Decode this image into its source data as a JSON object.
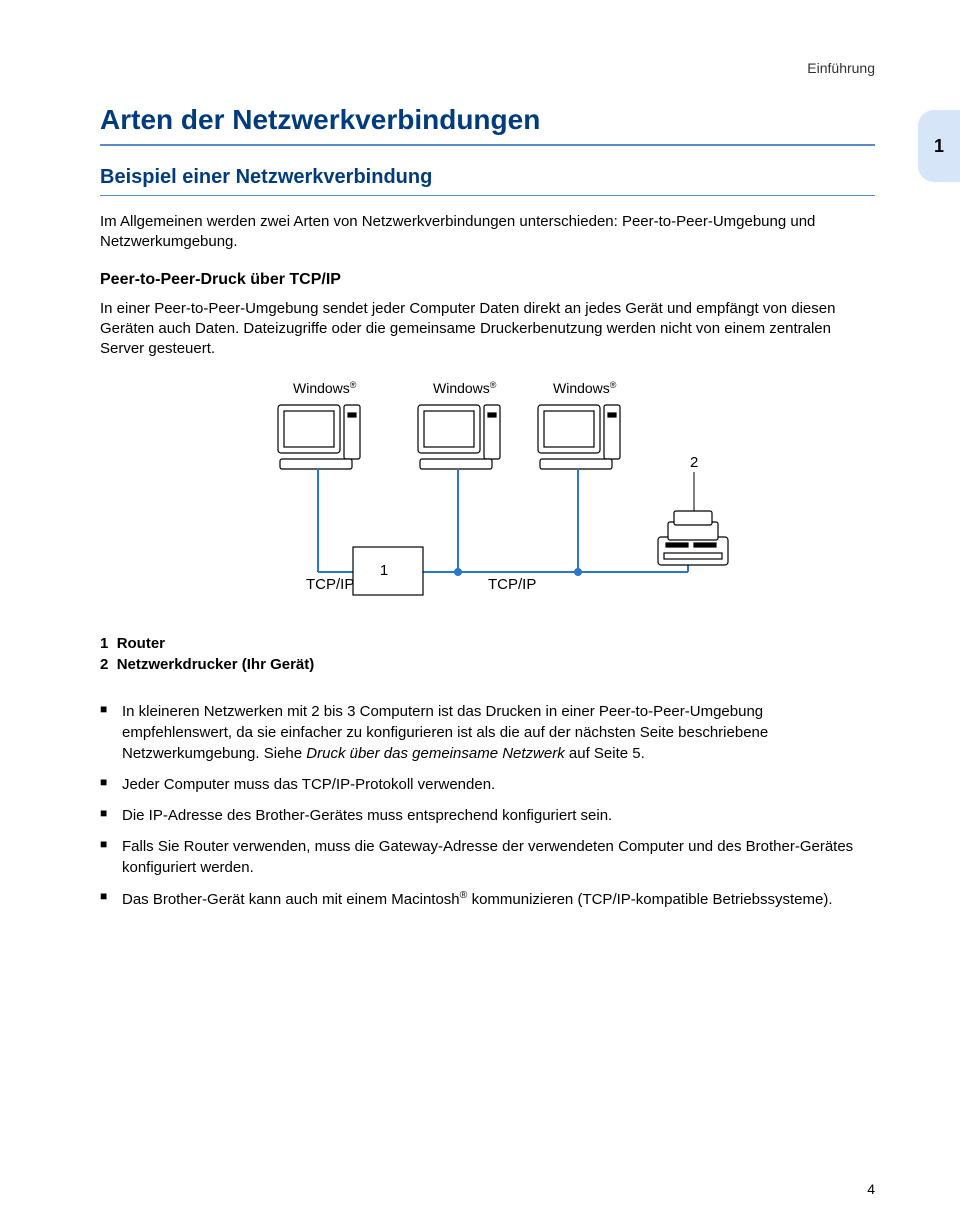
{
  "header_label": "Einführung",
  "side_badge": "1",
  "h1": "Arten der Netzwerkverbindungen",
  "h2": "Beispiel einer Netzwerkverbindung",
  "intro": "Im Allgemeinen werden zwei Arten von Netzwerkverbindungen unterschieden: Peer-to-Peer-Umgebung und Netzwerkumgebung.",
  "h3": "Peer-to-Peer-Druck über TCP/IP",
  "p2p_text": "In einer Peer-to-Peer-Umgebung sendet jeder Computer Daten direkt an jedes Gerät und empfängt von diesen Geräten auch Daten. Dateizugriffe oder die gemeinsame Druckerbenutzung werden nicht von einem zentralen Server gesteuert.",
  "diagram": {
    "os_label": "Windows",
    "reg": "®",
    "tcp_label": "TCP/IP",
    "router_num": "1",
    "printer_num": "2"
  },
  "legend": {
    "one_num": "1",
    "one_text": "Router",
    "two_num": "2",
    "two_text": "Netzwerkdrucker (Ihr Gerät)"
  },
  "bullets": [
    "In kleineren Netzwerken mit 2 bis 3 Computern ist das Drucken in einer Peer-to-Peer-Umgebung empfehlenswert, da sie einfacher zu konfigurieren ist als die auf der nächsten Seite beschriebene Netzwerkumgebung. Siehe ",
    "Jeder Computer muss das TCP/IP-Protokoll verwenden.",
    "Die IP-Adresse des Brother-Gerätes muss entsprechend konfiguriert sein.",
    "Falls Sie Router verwenden, muss die Gateway-Adresse der verwendeten Computer und des Brother-Gerätes konfiguriert werden.",
    "Das Brother-Gerät kann auch mit einem Macintosh"
  ],
  "bullet0_italic": "Druck über das gemeinsame Netzwerk",
  "bullet0_tail": " auf Seite 5.",
  "bullet4_tail": " kommunizieren (TCP/IP-kompatible Betriebssysteme).",
  "reg_mark": "®",
  "page_number": "4"
}
